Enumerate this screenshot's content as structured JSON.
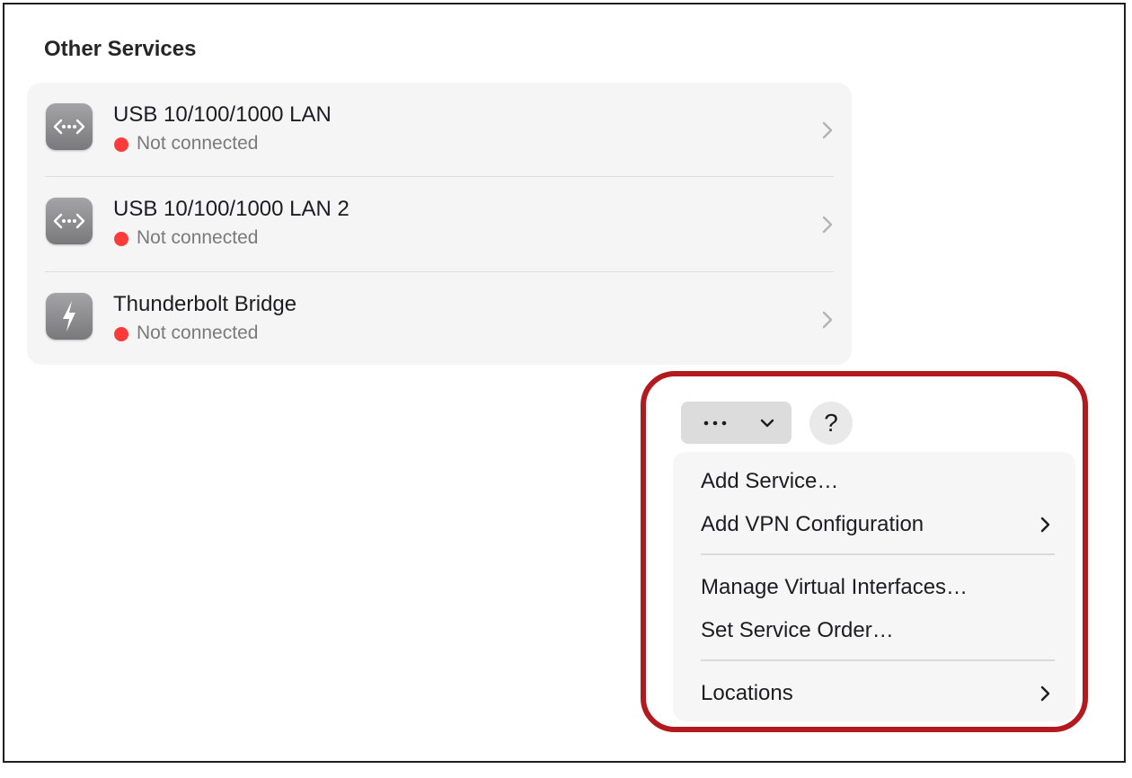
{
  "section": {
    "title": "Other Services"
  },
  "services": [
    {
      "name": "USB 10/100/1000 LAN",
      "status": "Not connected",
      "icon": "ethernet-icon"
    },
    {
      "name": "USB 10/100/1000 LAN 2",
      "status": "Not connected",
      "icon": "ethernet-icon"
    },
    {
      "name": "Thunderbolt Bridge",
      "status": "Not connected",
      "icon": "thunderbolt-icon"
    }
  ],
  "toolbar": {
    "action_icon": "ellipsis-icon",
    "dropdown_icon": "chevron-down-icon",
    "help_label": "?"
  },
  "menu": {
    "items": [
      {
        "label": "Add Service…",
        "has_submenu": false
      },
      {
        "label": "Add VPN Configuration",
        "has_submenu": true
      },
      {
        "label": "Manage Virtual Interfaces…",
        "has_submenu": false
      },
      {
        "label": "Set Service Order…",
        "has_submenu": false
      },
      {
        "label": "Locations",
        "has_submenu": true
      }
    ]
  },
  "colors": {
    "status_disconnected": "#fe3b3b",
    "highlight": "#b3191d"
  }
}
